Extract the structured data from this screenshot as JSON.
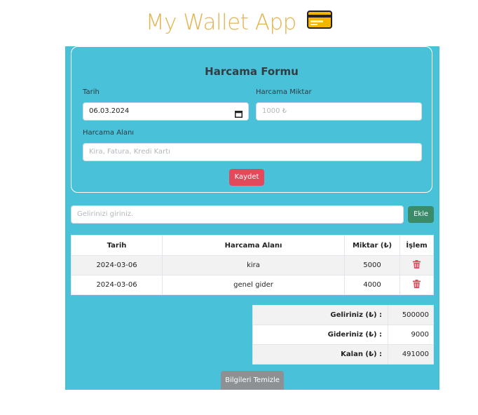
{
  "app": {
    "title": "My Wallet App",
    "icon": "credit-card-icon",
    "accent_color": "#e4b450"
  },
  "form": {
    "title": "Harcama Formu",
    "date_label": "Tarih",
    "date_value": "06.03.2024",
    "amount_label": "Harcama Miktar",
    "amount_placeholder": "1000 ₺",
    "area_label": "Harcama Alanı",
    "area_placeholder": "Kira, Fatura, Kredi Kartı",
    "save_label": "Kaydet"
  },
  "income": {
    "placeholder": "Gelirinizi giriniz.",
    "add_label": "Ekle"
  },
  "table": {
    "headers": [
      "Tarih",
      "Harcama Alanı",
      "Miktar (₺)",
      "İşlem"
    ],
    "rows": [
      {
        "date": "2024-03-06",
        "area": "kira",
        "amount": "5000",
        "action_icon": "trash-icon"
      },
      {
        "date": "2024-03-06",
        "area": "genel gider",
        "amount": "4000",
        "action_icon": "trash-icon"
      }
    ]
  },
  "summary": [
    {
      "label": "Geliriniz (₺) :",
      "value": "500000"
    },
    {
      "label": "Gideriniz (₺) :",
      "value": "9000"
    },
    {
      "label": "Kalan (₺) :",
      "value": "491000"
    }
  ],
  "clear_label": "Bilgileri Temizle",
  "colors": {
    "panel": "#49c2d9",
    "save": "#e24a5c",
    "add": "#3b8b6b",
    "clear": "#8d9193",
    "delete": "#e24a5c"
  }
}
